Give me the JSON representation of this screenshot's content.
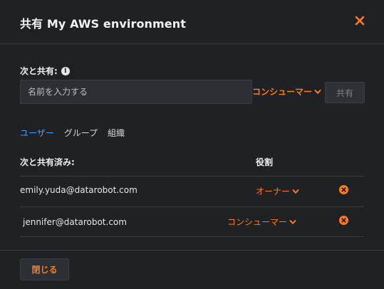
{
  "dialog": {
    "title": "共有 My AWS environment",
    "close_icon": "close-icon"
  },
  "share": {
    "label": "次と共有:",
    "info_icon": "info-icon",
    "input_placeholder": "名前を入力する",
    "input_value": "",
    "role": "コンシューマー",
    "share_button": "共有"
  },
  "tabs": [
    {
      "label": "ユーザー",
      "active": true
    },
    {
      "label": "グループ",
      "active": false
    },
    {
      "label": "組織",
      "active": false
    }
  ],
  "table": {
    "headers": {
      "shared_with": "次と共有済み:",
      "role": "役割"
    },
    "rows": [
      {
        "email": "emily.yuda@datarobot.com",
        "role": "オーナー"
      },
      {
        "email": "jennifer@datarobot.com",
        "role": "コンシューマー"
      }
    ]
  },
  "footer": {
    "close_button": "閉じる"
  },
  "colors": {
    "accent": "#ff7a1a",
    "link": "#3aa0ff",
    "background": "#1f2125"
  }
}
